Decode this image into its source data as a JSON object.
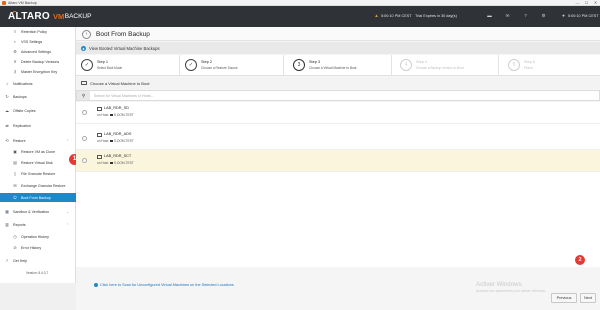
{
  "window": {
    "title": "Altaro VM Backup",
    "controls": [
      "—",
      "☐",
      "✕"
    ]
  },
  "header": {
    "logo_main": "ALTARO",
    "logo_vm": "VM",
    "logo_sub": "BACKUP",
    "server_time": "5:00:10 PM CEST",
    "trial_text": "Trial Expires in 30 day(s)",
    "right_time": "5:00:10 PM CEST",
    "icons": [
      "alert-icon",
      "chat-icon",
      "mail-icon",
      "help-icon",
      "gear-icon",
      "user-icon"
    ]
  },
  "sidebar": {
    "items": [
      {
        "label": "Retention Policy",
        "indent": true
      },
      {
        "label": "VSS Settings",
        "indent": true
      },
      {
        "label": "Advanced Settings",
        "indent": true
      },
      {
        "label": "Delete Backup Versions",
        "indent": true
      },
      {
        "label": "Master Encryption Key",
        "indent": true
      },
      {
        "label": "Notifications",
        "indent": false
      },
      {
        "label": "Backups",
        "indent": false
      },
      {
        "label": "Offsite Copies",
        "indent": false
      },
      {
        "label": "Replication",
        "indent": false
      },
      {
        "label": "Restore",
        "indent": false
      },
      {
        "label": "Restore VM as Clone",
        "indent": true
      },
      {
        "label": "Restore Virtual Disk",
        "indent": true
      },
      {
        "label": "File Granular Restore",
        "indent": true
      },
      {
        "label": "Exchange Granular Restore",
        "indent": true
      },
      {
        "label": "Boot From Backup",
        "indent": true
      },
      {
        "label": "Sandbox & Verification",
        "indent": false
      },
      {
        "label": "Reports",
        "indent": false
      },
      {
        "label": "Operation History",
        "indent": true
      },
      {
        "label": "Error History",
        "indent": true
      },
      {
        "label": "Get Help",
        "indent": false
      }
    ],
    "version": "Version: 8.4.0.7"
  },
  "main": {
    "title": "Boot From Backup",
    "subtitle": "View Booted Virtual Machine Backups",
    "steps": [
      {
        "title": "Step 1",
        "desc": "Select Boot Mode",
        "num": "✓"
      },
      {
        "title": "Step 2",
        "desc": "Choose a Restore Source",
        "num": "✓"
      },
      {
        "title": "Step 3",
        "desc": "Choose a Virtual Machine to Boot",
        "num": "3"
      },
      {
        "title": "Step 4",
        "desc": "Choose a Backup Version to Boot",
        "num": "4"
      },
      {
        "title": "Step 5",
        "desc": "Finish",
        "num": "5"
      }
    ],
    "choose_label": "Choose a Virtual Machine to Boot",
    "search_placeholder": "Search for Virtual Machines or Hosts...",
    "vms": [
      {
        "name": "LAB_RDR_SD",
        "host_prefix": "on Host:",
        "host": "S-DOM-TEST"
      },
      {
        "name": "LAB_RDR_ADS",
        "host_prefix": "on Host:",
        "host": "S-DOM-TEST"
      },
      {
        "name": "LAB_RDR_SCT",
        "host_prefix": "on Host:",
        "host": "S-DOM-TEST"
      }
    ],
    "rescan_link": "Click here to Scan for Unconfigured Virtual Machines on the Selected Locations",
    "activate_title": "Activer Windows",
    "activate_sub": "Accédez aux paramètres pour activer Windows.",
    "previous_button": "Previous",
    "next_button": "Next",
    "badge1": "1",
    "badge2": "2"
  },
  "colors": {
    "accent": "#1f88c6",
    "header_bg": "#2f3236",
    "brand_orange": "#e06a1b",
    "selected_row": "#fbf5de",
    "badge": "#e53935"
  }
}
